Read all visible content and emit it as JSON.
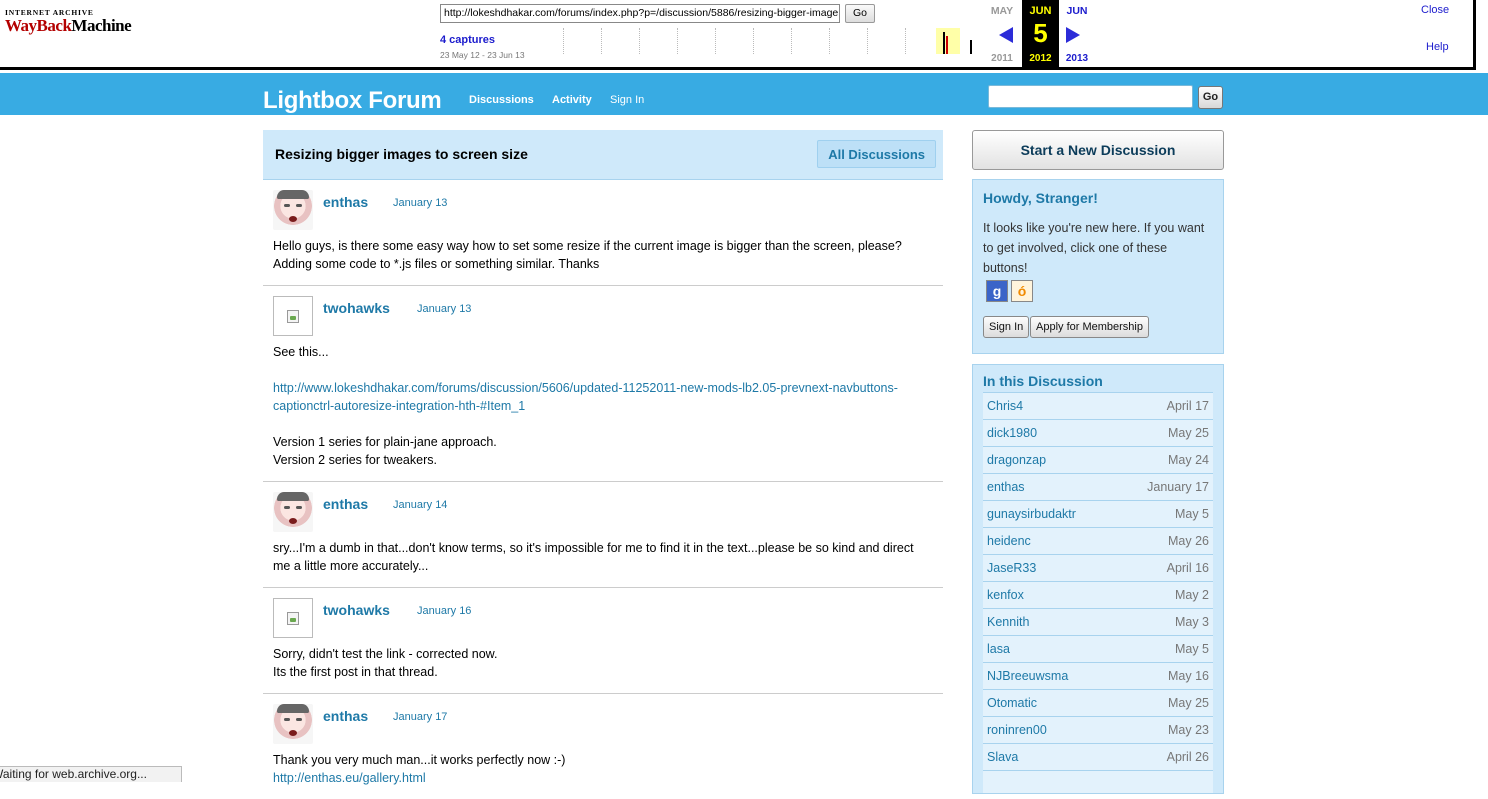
{
  "wayback": {
    "logo_top": "INTERNET ARCHIVE",
    "logo_wayback": "WayBack",
    "logo_machine": "Machine",
    "url": "http://lokeshdhakar.com/forums/index.php?p=/discussion/5886/resizing-bigger-image",
    "go_label": "Go",
    "captures": "4 captures",
    "range": "23 May 12 - 23 Jun 13",
    "prev_month": "MAY",
    "prev_year": "2011",
    "cur_month": "JUN",
    "cur_day": "5",
    "cur_year": "2012",
    "next_month": "JUN",
    "next_year": "2013",
    "close": "Close",
    "help": "Help",
    "colors": {
      "link": "#1c1ccd",
      "current_bg": "#000000",
      "current_fg": "#ffff00"
    }
  },
  "header": {
    "title": "Lightbox Forum",
    "nav": [
      "Discussions",
      "Activity",
      "Sign In"
    ],
    "search_go": "Go",
    "bg_color": "#38abe3"
  },
  "discussion": {
    "title": "Resizing bigger images to screen size",
    "all_discussions": "All Discussions",
    "comments": [
      {
        "author": "enthas",
        "date": "January 13",
        "avatar": "face",
        "paragraphs": [
          "Hello guys, is there some easy way how to set some resize if the current image is bigger than the screen, please? Adding some code to *.js files or something similar. Thanks"
        ]
      },
      {
        "author": "twohawks",
        "date": "January 13",
        "avatar": "broken-image",
        "paragraphs": [
          "See this...",
          "http://www.lokeshdhakar.com/forums/discussion/5606/updated-11252011-new-mods-lb2.05-prevnext-navbuttons-captionctrl-autoresize-integration-hth-#Item_1",
          "Version 1 series for plain-jane approach.",
          "Version 2 series for tweakers."
        ]
      },
      {
        "author": "enthas",
        "date": "January 14",
        "avatar": "face",
        "paragraphs": [
          "sry...I'm a dumb in that...don't know terms, so it's impossible for me to find it in the text...please be so kind and direct me a little more accurately..."
        ]
      },
      {
        "author": "twohawks",
        "date": "January 16",
        "avatar": "broken-image",
        "paragraphs": [
          "Sorry, didn't test the link - corrected now.",
          "Its the first post in that thread."
        ]
      },
      {
        "author": "enthas",
        "date": "January 17",
        "avatar": "face",
        "paragraphs": [
          "Thank you very much man...it works perfectly now :-)",
          "http://enthas.eu/gallery.html"
        ]
      }
    ]
  },
  "sidebar": {
    "start_button": "Start a New Discussion",
    "howdy_title": "Howdy, Stranger!",
    "howdy_text": "It looks like you're new here. If you want to get involved, click one of these buttons!",
    "google_icon": "google-icon",
    "openid_icon": "openid-icon",
    "sign_in": "Sign In",
    "apply": "Apply for Membership",
    "in_this_title": "In this Discussion",
    "participants": [
      {
        "name": "Chris4",
        "date": "April 17"
      },
      {
        "name": "dick1980",
        "date": "May 25"
      },
      {
        "name": "dragonzap",
        "date": "May 24"
      },
      {
        "name": "enthas",
        "date": "January 17"
      },
      {
        "name": "gunaysirbudaktr",
        "date": "May 5"
      },
      {
        "name": "heidenc",
        "date": "May 26"
      },
      {
        "name": "JaseR33",
        "date": "April 16"
      },
      {
        "name": "kenfox",
        "date": "May 2"
      },
      {
        "name": "Kennith",
        "date": "May 3"
      },
      {
        "name": "lasa",
        "date": "May 5"
      },
      {
        "name": "NJBreeuwsma",
        "date": "May 16"
      },
      {
        "name": "Otomatic",
        "date": "May 25"
      },
      {
        "name": "roninren00",
        "date": "May 23"
      },
      {
        "name": "Slava",
        "date": "April 26"
      },
      {
        "name": "",
        "date": ""
      }
    ]
  },
  "status_bar": "Waiting for web.archive.org..."
}
